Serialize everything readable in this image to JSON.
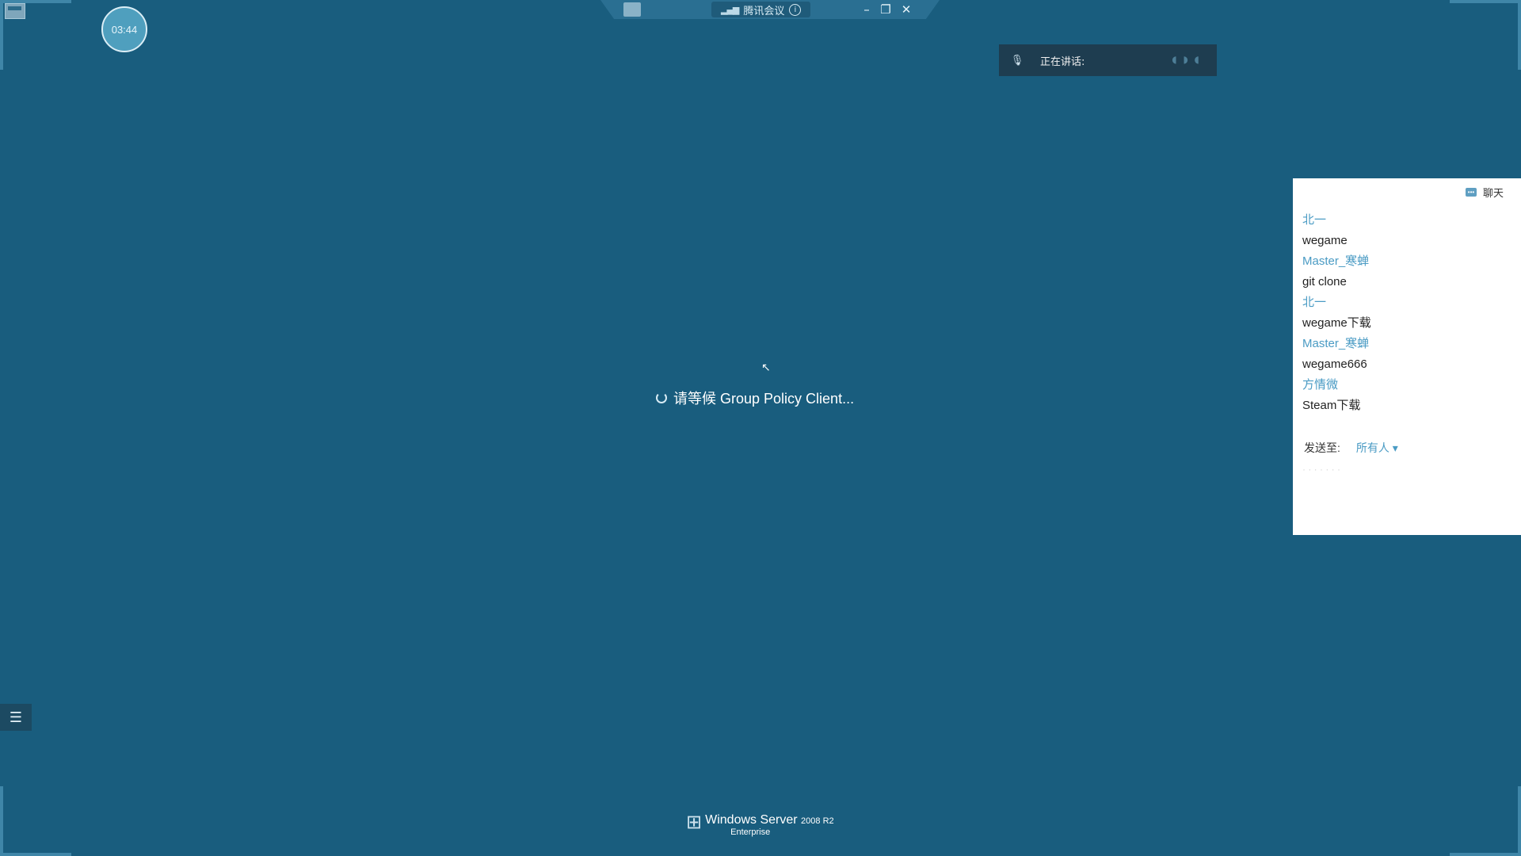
{
  "titlebar": {
    "app_title": "腾讯会议",
    "signal_icon": "signal-icon",
    "info_icon": "info-icon",
    "minimize": "–",
    "restore": "❐",
    "close": "✕"
  },
  "timer": {
    "value": "03:44"
  },
  "speaking": {
    "label": "正在讲话:"
  },
  "remote_desktop": {
    "status_text": "请等候 Group Policy Client...",
    "brand_name": "Windows Server",
    "brand_version": "2008 R2",
    "brand_edition": "Enterprise"
  },
  "chat": {
    "title": "聊天",
    "messages": [
      {
        "sender": "北一",
        "text": "wegame"
      },
      {
        "sender": "Master_寒蝉",
        "text": "git clone"
      },
      {
        "sender": "北一",
        "text": "wegame下载"
      },
      {
        "sender": "Master_寒蝉",
        "text": "wegame666"
      },
      {
        "sender": "方情微",
        "text": "Steam下载"
      }
    ],
    "send_to_label": "发送至:",
    "send_to_target": "所有人 ▾"
  },
  "colors": {
    "background": "#195d7e",
    "chat_sender": "#4a9bc4",
    "chat_bg": "#ffffff",
    "speaking_bg": "#1e3d50"
  }
}
